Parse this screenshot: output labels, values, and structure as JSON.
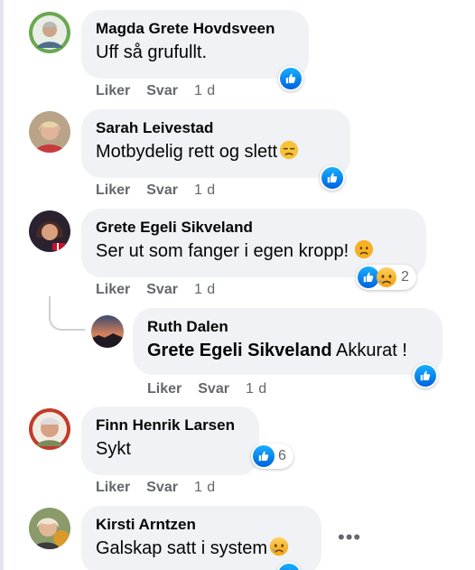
{
  "comments": [
    {
      "name": "Magda Grete Hovdsveen",
      "text": "Uff så grufullt.",
      "like": "Liker",
      "reply": "Svar",
      "time": "1 d"
    },
    {
      "name": "Sarah Leivestad",
      "text": "Motbydelig rett og slett",
      "like": "Liker",
      "reply": "Svar",
      "time": "1 d"
    },
    {
      "name": "Grete Egeli Sikveland",
      "text": "Ser ut som fanger i egen kropp!",
      "like": "Liker",
      "reply": "Svar",
      "time": "1 d",
      "reaction_count": "2"
    },
    {
      "name": "Ruth Dalen",
      "mention": "Grete Egeli Sikveland",
      "text": "Akkurat !",
      "like": "Liker",
      "reply": "Svar",
      "time": "1 d"
    },
    {
      "name": "Finn Henrik Larsen",
      "text": "Sykt",
      "like": "Liker",
      "reply": "Svar",
      "time": "1 d",
      "reaction_count": "6"
    },
    {
      "name": "Kirsti Arntzen",
      "text": "Galskap satt i system",
      "more": "•••"
    }
  ],
  "icons": {
    "like": "like-icon",
    "sad": "sad-emoji-icon",
    "more": "more-options-icon"
  },
  "colors": {
    "bubble": "#f0f2f5",
    "like_blue": "#1877f2",
    "meta_grey": "#65676b"
  }
}
